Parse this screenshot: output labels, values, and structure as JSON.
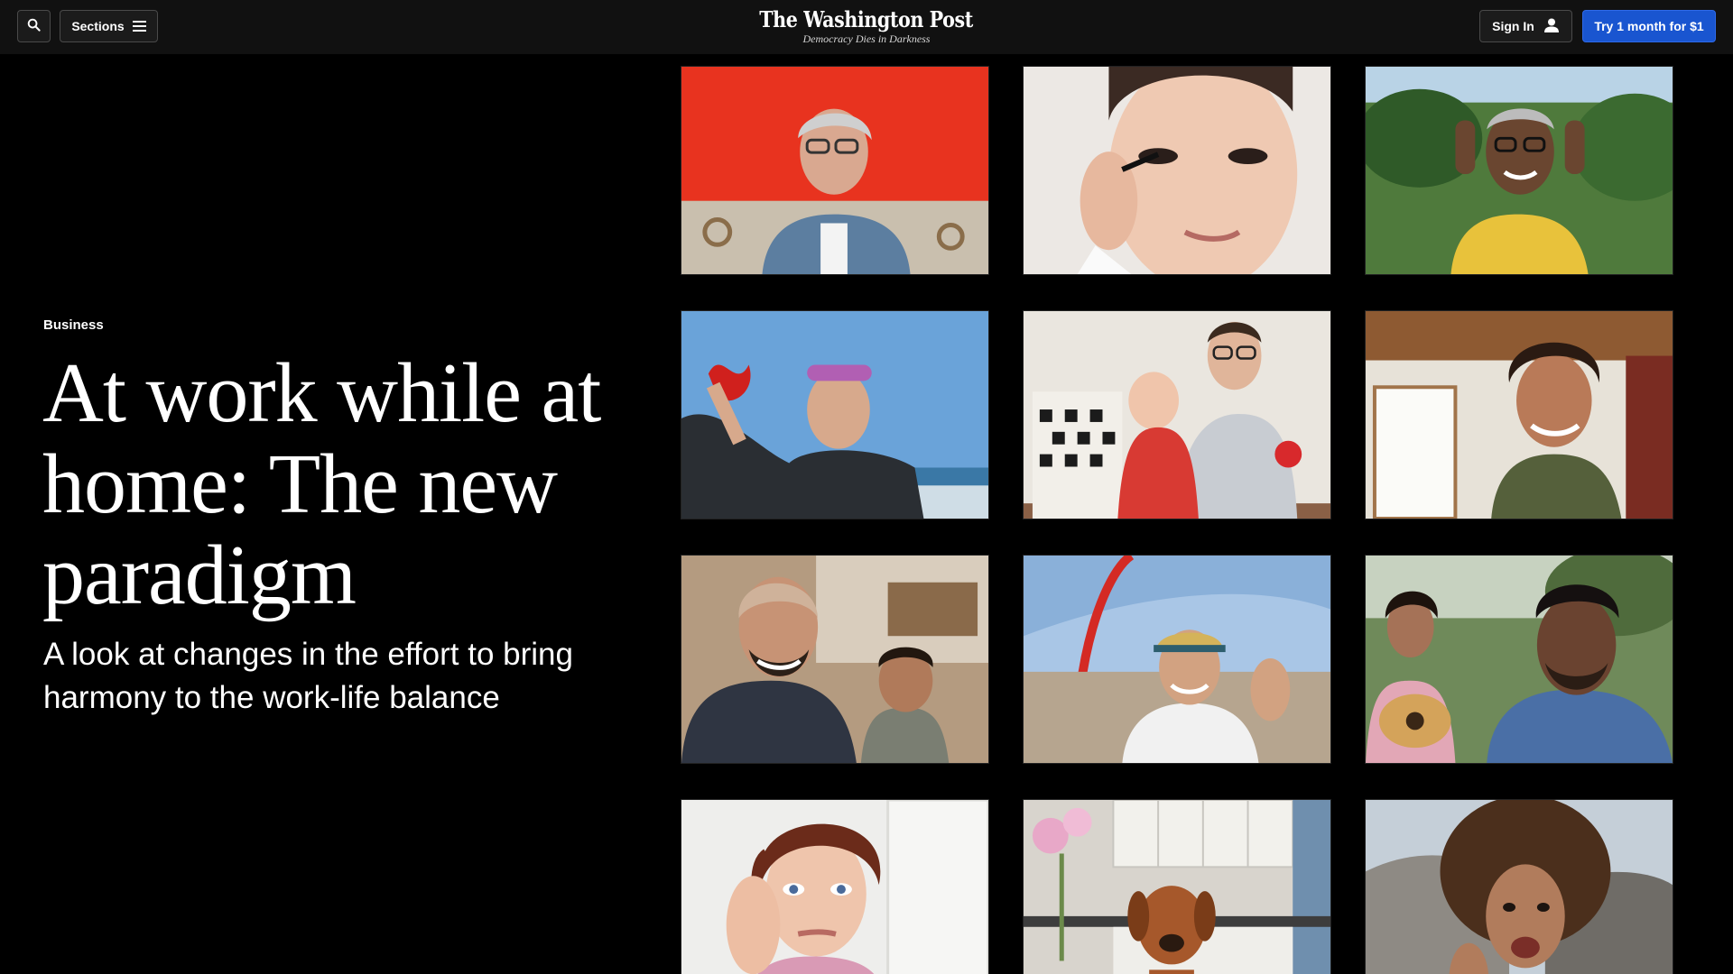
{
  "header": {
    "search_icon": "search-icon",
    "sections_label": "Sections",
    "menu_icon": "hamburger-menu-icon",
    "logo_text": "The Washington Post",
    "tagline": "Democracy Dies in Darkness",
    "signin_label": "Sign In",
    "user_icon": "user-icon",
    "subscribe_label": "Try 1 month for $1",
    "subscribe_color": "#1955d0"
  },
  "story": {
    "section": "Business",
    "headline": "At work while at home: The new paradigm",
    "dek": "A look at changes in the effort to bring harmony to the work-life balance"
  },
  "photo_grid": {
    "tiles": [
      "woman-with-glasses-red-wall",
      "woman-applying-mascara",
      "woman-glasses-yellow-shirt-outdoors",
      "swimmer-with-goggles-at-beach",
      "man-with-baby",
      "smiling-woman-at-home",
      "man-with-child-in-kitchen",
      "man-in-tent",
      "man-and-girl-with-guitar",
      "woman-hand-on-cheek",
      "dog-in-kitchen",
      "woman-with-curly-hair-outdoors"
    ]
  }
}
